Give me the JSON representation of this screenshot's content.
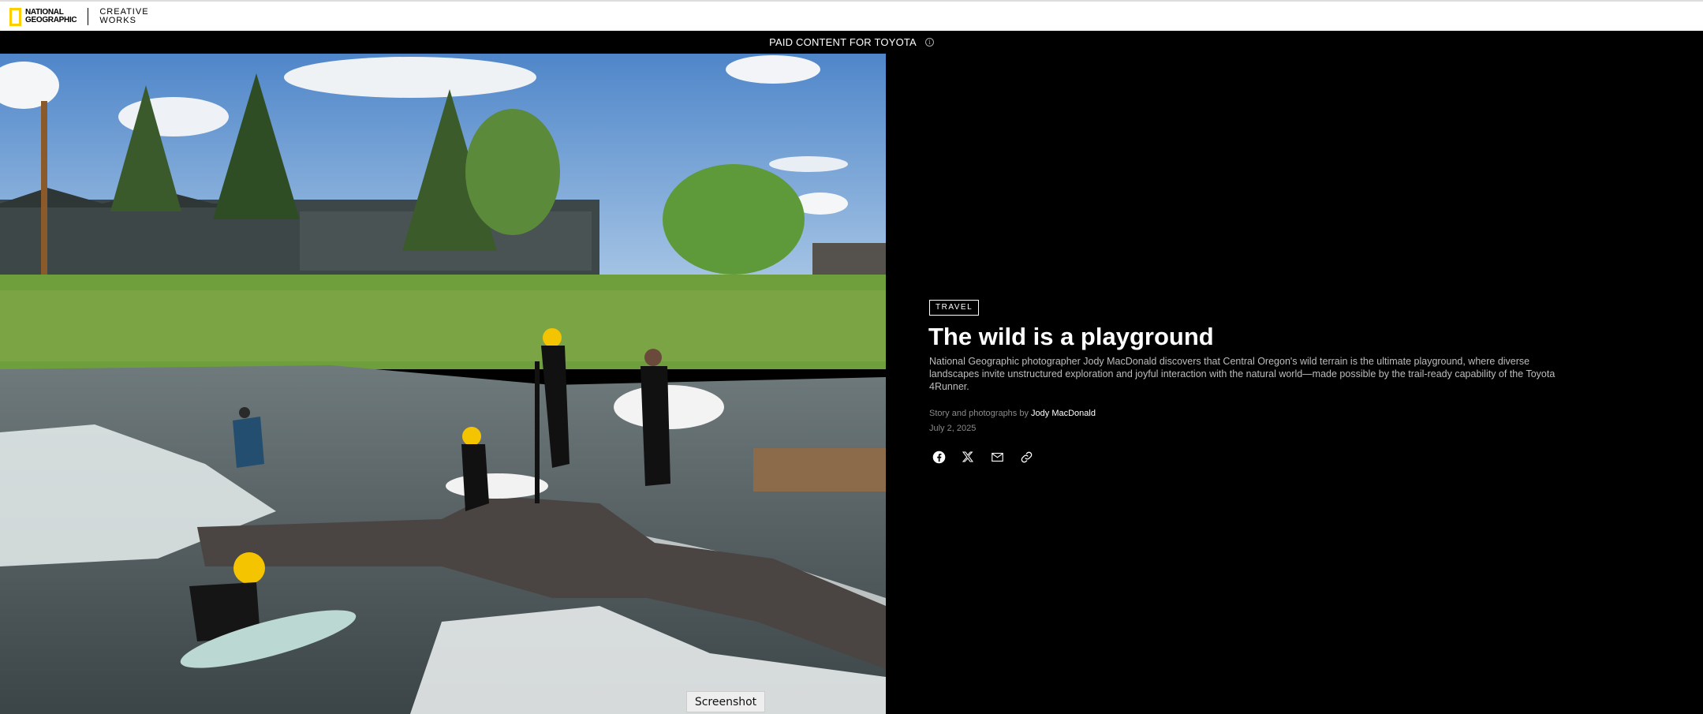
{
  "header": {
    "brand_line1": "NATIONAL",
    "brand_line2": "GEOGRAPHIC",
    "sub_line1": "CREATIVE",
    "sub_line2": "WORKS"
  },
  "sponsor": {
    "label": "PAID CONTENT FOR TOYOTA",
    "info_glyph": "i"
  },
  "article": {
    "category": "TRAVEL",
    "title": "The wild is a playground",
    "dek": "National Geographic photographer Jody MacDonald discovers that Central Oregon's wild terrain is the ultimate playground, where diverse landscapes invite unstructured exploration and joyful interaction with the natural world—made possible by the trail-ready capability of the Toyota 4Runner.",
    "byline_prefix": "Story and photographs by ",
    "author": "Jody MacDonald",
    "date": "July 2, 2025"
  },
  "share": [
    "facebook-icon",
    "x-icon",
    "mail-icon",
    "link-icon"
  ],
  "overlay": {
    "screenshot_label": "Screenshot"
  },
  "colors": {
    "accent_yellow": "#FFCE00",
    "background": "#000000",
    "text_light": "#bdbdbd"
  }
}
